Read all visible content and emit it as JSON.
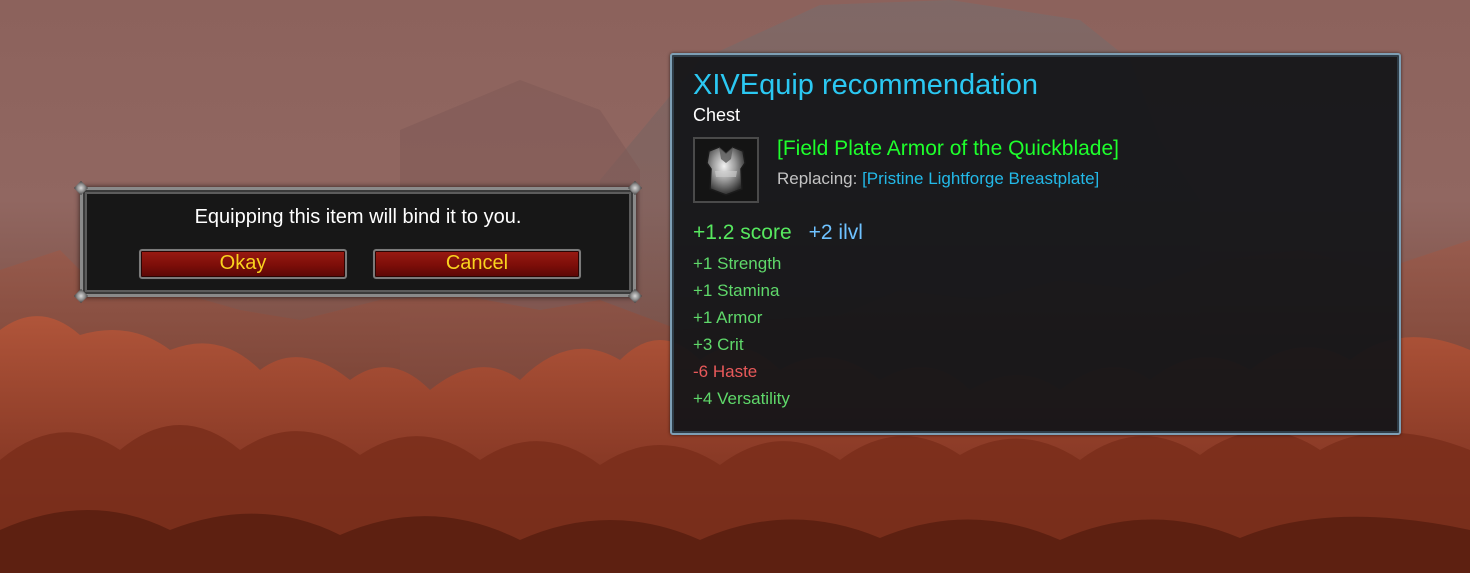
{
  "confirm_dialog": {
    "message": "Equipping this item will bind it to you.",
    "okay_label": "Okay",
    "cancel_label": "Cancel"
  },
  "tooltip": {
    "title": "XIVEquip recommendation",
    "slot": "Chest",
    "item_icon": "chest-armor-icon",
    "item_name": "[Field Plate Armor of the Quickblade]",
    "replacing_prefix": "Replacing:",
    "replacing_item": "[Pristine Lightforge Breastplate]",
    "score_delta": "+1.2 score",
    "ilvl_delta": "+2 ilvl",
    "stats": [
      {
        "text": "+1 Strength",
        "positive": true
      },
      {
        "text": "+1 Stamina",
        "positive": true
      },
      {
        "text": "+1 Armor",
        "positive": true
      },
      {
        "text": "+3 Crit",
        "positive": true
      },
      {
        "text": "-6 Haste",
        "positive": false
      },
      {
        "text": "+4 Versatility",
        "positive": true
      }
    ]
  },
  "colors": {
    "title_cyan": "#2bc8f2",
    "uncommon_green": "#1eff2c",
    "stat_positive": "#5fd86a",
    "stat_negative": "#e8595a",
    "button_text_gold": "#f9d21e",
    "button_red": "#7c0e09"
  }
}
